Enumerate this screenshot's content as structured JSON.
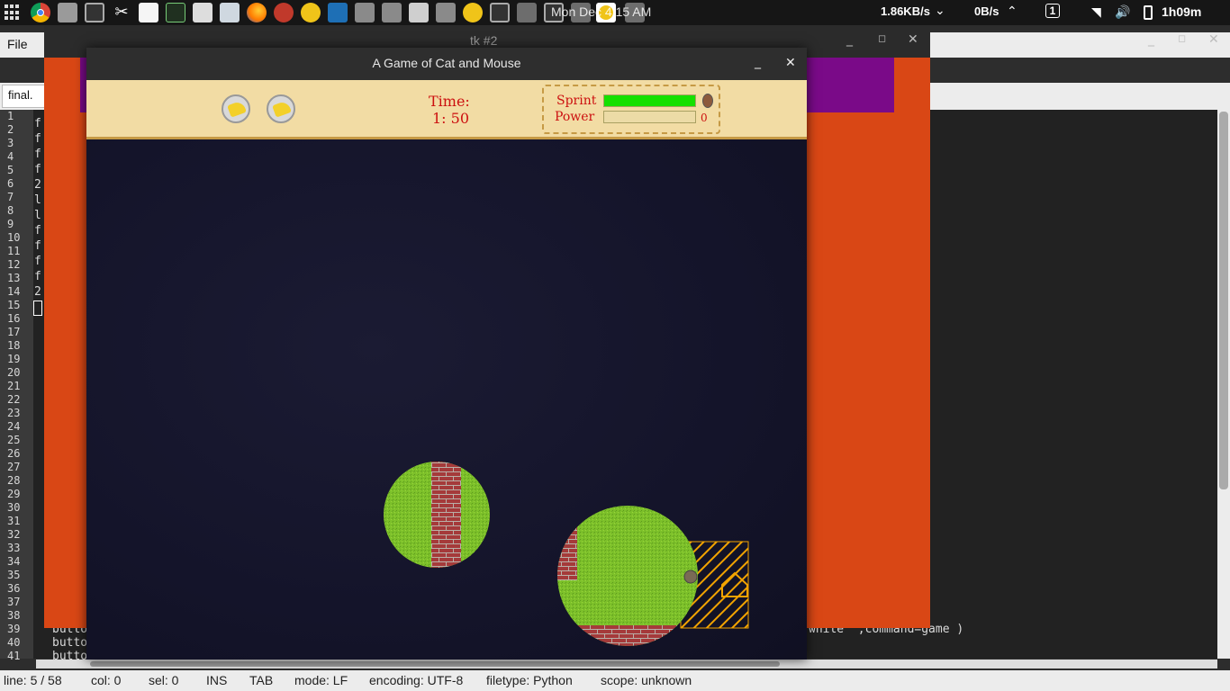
{
  "top_panel": {
    "clock": "Mon Dec 4:15 AM",
    "net_down": "1.86KB/s",
    "net_up": "0B/s",
    "workspace": "1",
    "battery": "1h09m"
  },
  "editor": {
    "menu_file": "File",
    "tab_label": "final.",
    "line_numbers": [
      "1",
      "2",
      "3",
      "4",
      "5",
      "6",
      "7",
      "8",
      "9",
      "10",
      "11",
      "12",
      "13",
      "14",
      "15",
      "16",
      "17",
      "18",
      "19",
      "20",
      "21",
      "22",
      "23",
      "24",
      "25",
      "26",
      "27",
      "28",
      "29",
      "30",
      "31",
      "32",
      "33",
      "34",
      "35",
      "36",
      "37",
      "38",
      "39",
      "40",
      "41"
    ],
    "code_prefixes": [
      "f'",
      "f'",
      "f'",
      "f'",
      "2",
      "l'",
      "l'",
      "f'",
      "f'",
      "f'",
      "f'",
      "2"
    ],
    "code_line_39": "butto",
    "code_line_39_tail": "white\" ,command=game )",
    "code_line_40": "butto",
    "code_line_41": "butto"
  },
  "tk2": {
    "title": "tk #2"
  },
  "game": {
    "title": "A Game of Cat and Mouse",
    "time_label": "Time:",
    "time_value": "1: 50",
    "sprint_label": "Sprint",
    "power_label": "Power",
    "sprint_fraction": 1.0,
    "power_fraction": 0.0,
    "power_value": "0",
    "lives": 2
  },
  "status_bar": {
    "line": "line: 5 / 58",
    "col": "col: 0",
    "sel": "sel: 0",
    "ins": "INS",
    "tab": "TAB",
    "mode": "mode: LF",
    "encoding": "encoding: UTF-8",
    "filetype": "filetype: Python",
    "scope": "scope: unknown"
  },
  "colors": {
    "panel_bg": "#161616",
    "tk2_orange": "#d94715",
    "tk2_purple": "#7a0a88",
    "hud_parchment": "#f2dca4",
    "hud_text_red": "#cc1010",
    "sprint_green": "#15e000",
    "field_bg": "#14142a",
    "grass": "#7cc02a",
    "brick": "#a53a3a",
    "mouse_hole_stripes": "#f2a300"
  }
}
